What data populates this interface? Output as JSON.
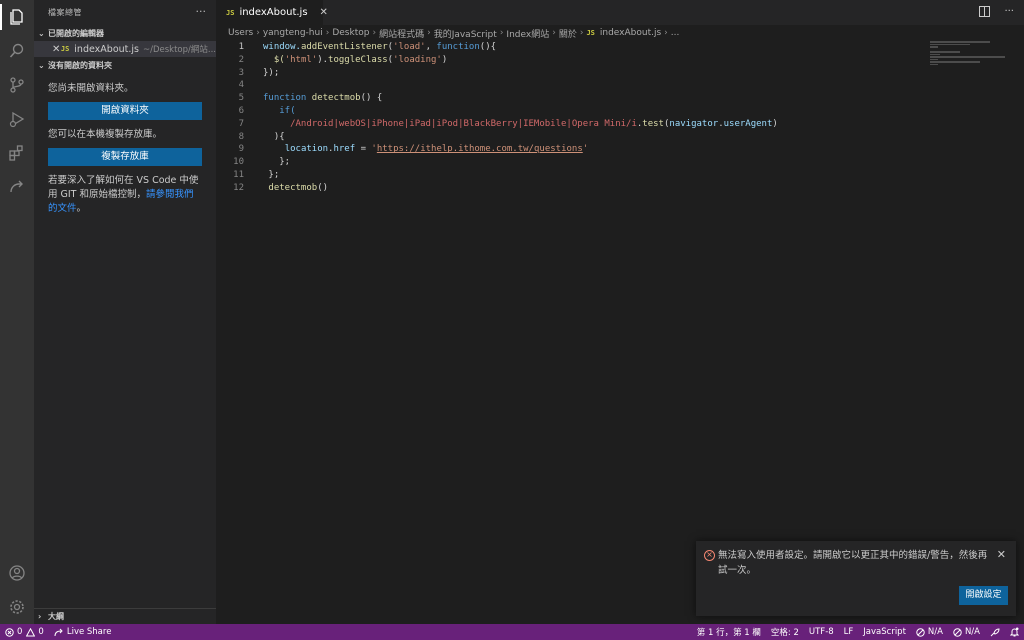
{
  "activity": {
    "icons": [
      "explorer-icon",
      "search-icon",
      "source-control-icon",
      "run-debug-icon",
      "extensions-icon",
      "live-share-icon",
      "account-icon",
      "settings-gear-icon"
    ]
  },
  "sidebar": {
    "title": "檔案總管",
    "more": "···",
    "open_editors_label": "已開啟的編輯器",
    "open_editor": {
      "close": "✕",
      "badge": "JS",
      "name": "indexAbout.js",
      "path": "~/Desktop/網站..."
    },
    "no_folder_label": "沒有開啟的資料夾",
    "no_folder_text": "您尚未開啟資料夾。",
    "open_folder_button": "開啟資料夾",
    "clone_text": "您可以在本機複製存放庫。",
    "clone_button": "複製存放庫",
    "learn_text": "若要深入了解如何在 VS Code 中使用 GIT 和原始檔控制，",
    "learn_link": "請參閱我們的文件",
    "learn_end": "。",
    "outline_label": "大綱"
  },
  "tab": {
    "badge": "JS",
    "name": "indexAbout.js",
    "close": "✕"
  },
  "breadcrumb": [
    "Users",
    "yangteng-hui",
    "Desktop",
    "網站程式碼",
    "我的JavaScript",
    "Index網站",
    "關於",
    "indexAbout.js",
    "..."
  ],
  "breadcrumb_badge": "JS",
  "code": {
    "l1": {
      "n": "1",
      "a": "window.",
      "b": "addEventListener",
      "c": "(",
      "d": "'load'",
      "e": ", ",
      "f": "function",
      "g": "(){"
    },
    "l2": {
      "n": "2",
      "a": "  $(",
      "b": "'html'",
      "c": ").",
      "d": "toggleClass",
      "e": "(",
      "f": "'loading'",
      "g": ")"
    },
    "l3": {
      "n": "3",
      "a": "});"
    },
    "l4": {
      "n": "4"
    },
    "l5": {
      "n": "5",
      "a": "function ",
      "b": "detectmob",
      "c": "() {"
    },
    "l6": {
      "n": "6",
      "a": "   if("
    },
    "l7": {
      "n": "7",
      "a": "     ",
      "b": "/Android|webOS|iPhone|iPad|iPod|BlackBerry|IEMobile|Opera Mini/i",
      "c": ".",
      "d": "test",
      "e": "(",
      "f": "navigator",
      "g": ".",
      "h": "userAgent",
      "i": ")"
    },
    "l8": {
      "n": "8",
      "a": "  ){"
    },
    "l9": {
      "n": "9",
      "a": "    ",
      "b": "location",
      "c": ".",
      "d": "href",
      "e": " = ",
      "f": "'",
      "g": "https://ithelp.ithome.com.tw/questions",
      "h": "'"
    },
    "l10": {
      "n": "10",
      "a": "   };"
    },
    "l11": {
      "n": "11",
      "a": " };"
    },
    "l12": {
      "n": "12",
      "a": " ",
      "b": "detectmob",
      "c": "()"
    }
  },
  "notification": {
    "message": "無法寫入使用者設定。請開啟它以更正其中的錯誤/警告，然後再試一次。",
    "close": "✕",
    "button": "開啟設定"
  },
  "statusbar": {
    "errors": "0",
    "warnings": "0",
    "live_share": "Live Share",
    "position": "第 1 行，第 1 欄",
    "spaces": "空格: 2",
    "encoding": "UTF-8",
    "eol": "LF",
    "language": "JavaScript",
    "na1": "N/A",
    "na2": "N/A"
  },
  "colors": {
    "accent": "#0e639c",
    "statusbar": "#68217a",
    "error": "#f48771"
  }
}
